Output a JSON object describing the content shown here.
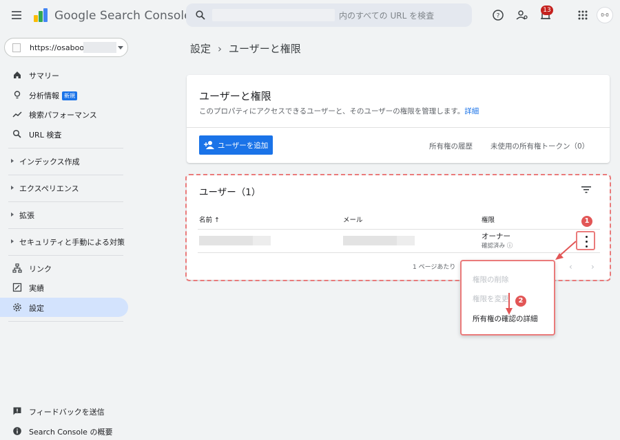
{
  "header": {
    "menu_icon": "hamburger-icon",
    "app_title": "Google Search Console",
    "search_placeholder": "内のすべての URL を検査",
    "notification_count": "13",
    "avatar_text": "0-0"
  },
  "sidebar": {
    "property_label": "https://osaboo",
    "nav": [
      {
        "label": "サマリー",
        "icon": "home-icon"
      },
      {
        "label": "分析情報",
        "icon": "lightbulb-icon",
        "badge": "新規"
      },
      {
        "label": "検索パフォーマンス",
        "icon": "trending-icon"
      },
      {
        "label": "URL 検査",
        "icon": "search-icon"
      }
    ],
    "sections": [
      "インデックス作成",
      "エクスペリエンス",
      "拡張",
      "セキュリティと手動による対策"
    ],
    "links": [
      {
        "label": "リンク",
        "icon": "sitemap-icon"
      },
      {
        "label": "実績",
        "icon": "edit-icon"
      },
      {
        "label": "設定",
        "icon": "gear-icon"
      }
    ],
    "footer": [
      {
        "label": "フィードバックを送信",
        "icon": "feedback-icon"
      },
      {
        "label": "Search Console の概要",
        "icon": "info-icon"
      }
    ]
  },
  "breadcrumb": {
    "parent": "設定",
    "current": "ユーザーと権限"
  },
  "permissions_card": {
    "title": "ユーザーと権限",
    "description": "このプロパティにアクセスできるユーザーと、そのユーザーの権限を管理します。",
    "detail_link": "詳細",
    "add_user_button": "ユーザーを追加",
    "ownership_history": "所有権の履歴",
    "unused_tokens": "未使用の所有権トークン（0）"
  },
  "users_card": {
    "title": "ユーザー（1）",
    "columns": {
      "name": "名前 ↑",
      "email": "メール",
      "permission": "権限"
    },
    "rows": [
      {
        "permission": "オーナー",
        "permission_sub": "確認済み ⓘ"
      }
    ],
    "pagination": "1 ページあたり"
  },
  "row_menu": {
    "items": [
      {
        "label": "権限の削除",
        "enabled": false
      },
      {
        "label": "権限を変更",
        "enabled": false
      },
      {
        "label": "所有権の確認の詳細",
        "enabled": true
      }
    ]
  },
  "annotations": {
    "step1": "1",
    "step2": "2",
    "color": "#e25656"
  },
  "colors": {
    "accent": "#1a73e8",
    "active_nav": "#d3e3fd",
    "badge": "#c5221f"
  }
}
